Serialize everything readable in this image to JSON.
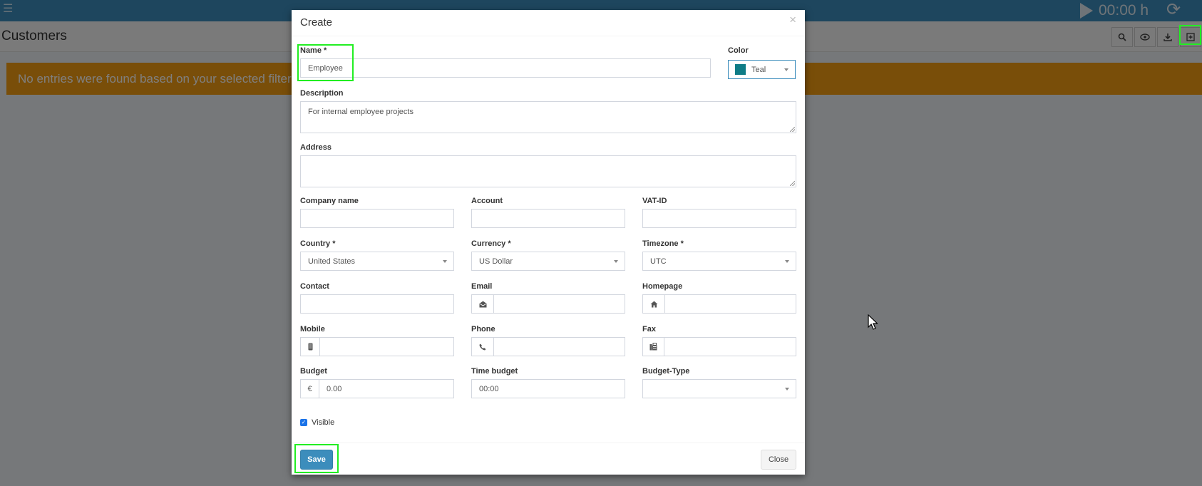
{
  "app": {
    "timer": "00:00 h",
    "page_title": "Customers",
    "alert": "No entries were found based on your selected filters."
  },
  "icons": {
    "menu": "hamburger-icon",
    "play": "play-icon",
    "refresh": "refresh-icon",
    "search": "search-icon",
    "view": "eye-icon",
    "download": "download-icon",
    "create": "plus-square-icon"
  },
  "modal": {
    "title": "Create",
    "close_x": "×",
    "fields": {
      "name": {
        "label": "Name *",
        "value": "Employee"
      },
      "color": {
        "label": "Color",
        "value": "Teal",
        "swatch": "#0e7c86"
      },
      "description": {
        "label": "Description",
        "value": "For internal employee projects"
      },
      "address": {
        "label": "Address",
        "value": ""
      },
      "company": {
        "label": "Company name",
        "value": ""
      },
      "account": {
        "label": "Account",
        "value": ""
      },
      "vat": {
        "label": "VAT-ID",
        "value": ""
      },
      "country": {
        "label": "Country *",
        "value": "United States"
      },
      "currency": {
        "label": "Currency *",
        "value": "US Dollar"
      },
      "timezone": {
        "label": "Timezone *",
        "value": "UTC"
      },
      "contact": {
        "label": "Contact",
        "value": ""
      },
      "email": {
        "label": "Email",
        "value": ""
      },
      "homepage": {
        "label": "Homepage",
        "value": ""
      },
      "mobile": {
        "label": "Mobile",
        "value": ""
      },
      "phone": {
        "label": "Phone",
        "value": ""
      },
      "fax": {
        "label": "Fax",
        "value": ""
      },
      "budget": {
        "label": "Budget",
        "currency_symbol": "€",
        "value": "0.00"
      },
      "time_budget": {
        "label": "Time budget",
        "value": "00:00"
      },
      "budget_type": {
        "label": "Budget-Type",
        "value": ""
      }
    },
    "visible": {
      "label": "Visible",
      "checked": true
    },
    "save_label": "Save",
    "close_label": "Close"
  },
  "colors": {
    "topbar": "#3c8dbc",
    "alert": "#f39c12",
    "primary_button": "#3c8dbc",
    "highlight": "#22ee22"
  }
}
